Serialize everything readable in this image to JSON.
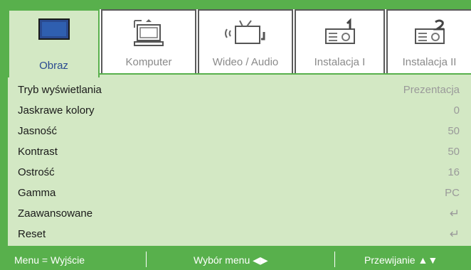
{
  "tabs": [
    {
      "label": "Obraz",
      "icon": "monitor-icon",
      "active": true
    },
    {
      "label": "Komputer",
      "icon": "computer-icon",
      "active": false
    },
    {
      "label": "Wideo / Audio",
      "icon": "video-audio-icon",
      "active": false
    },
    {
      "label": "Instalacja I",
      "icon": "projector-setup-1-icon",
      "active": false
    },
    {
      "label": "Instalacja II",
      "icon": "projector-setup-2-icon",
      "active": false
    }
  ],
  "rows": [
    {
      "label": "Tryb wyświetlania",
      "value": "Prezentacja"
    },
    {
      "label": "Jaskrawe kolory",
      "value": "0"
    },
    {
      "label": "Jasność",
      "value": "50"
    },
    {
      "label": "Kontrast",
      "value": "50"
    },
    {
      "label": "Ostrość",
      "value": "16"
    },
    {
      "label": "Gamma",
      "value": "PC"
    },
    {
      "label": "Zaawansowane",
      "value": "↵",
      "icon": "enter-icon"
    },
    {
      "label": "Reset",
      "value": "↵",
      "icon": "enter-icon"
    }
  ],
  "footer": {
    "menu_hint": "Menu = Wyjście",
    "select_hint": "Wybór menu ◀▶",
    "scroll_hint": "Przewijanie ▲▼"
  },
  "colors": {
    "accent": "#58b04c",
    "panel": "#d3e8c4",
    "active_label": "#2a4a90"
  }
}
